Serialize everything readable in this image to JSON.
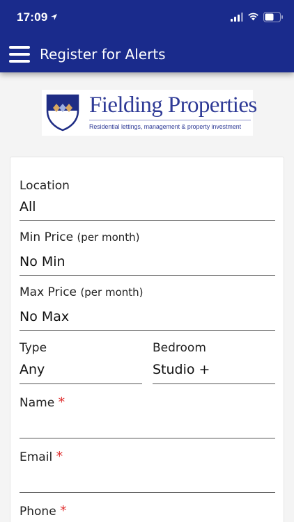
{
  "status_bar": {
    "time": "17:09"
  },
  "nav": {
    "title": "Register for Alerts"
  },
  "brand": {
    "name": "Fielding Properties",
    "tagline": "Residential lettings, management & property investment"
  },
  "form": {
    "location": {
      "label": "Location",
      "value": "All"
    },
    "min_price": {
      "label": "Min Price",
      "sub": "(per month)",
      "value": "No Min"
    },
    "max_price": {
      "label": "Max Price",
      "sub": "(per month)",
      "value": "No Max"
    },
    "type": {
      "label": "Type",
      "value": "Any"
    },
    "bedroom": {
      "label": "Bedroom",
      "value": "Studio +"
    },
    "name": {
      "label": "Name",
      "required": "*"
    },
    "email": {
      "label": "Email",
      "required": "*"
    },
    "phone": {
      "label": "Phone",
      "required": "*"
    }
  },
  "colors": {
    "header": "#1a2b8c",
    "brand": "#2e3a96",
    "required": "#e03030"
  }
}
